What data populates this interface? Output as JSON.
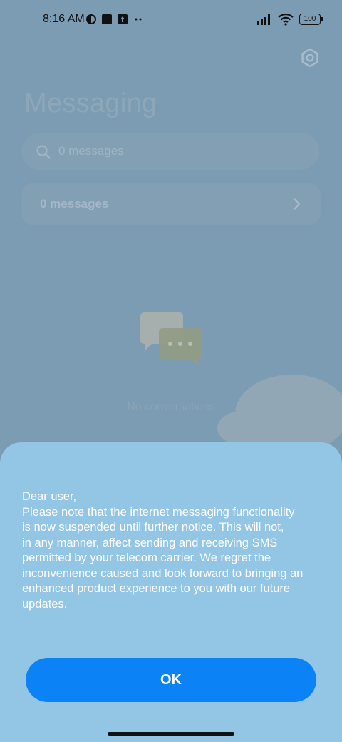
{
  "status_bar": {
    "time": "8:16 AM",
    "battery": "100",
    "left_icons": [
      "vpn-icon",
      "square-icon",
      "upload-icon",
      "more-dots-icon"
    ],
    "right_icons": [
      "signal-icon",
      "wifi-icon",
      "battery-icon"
    ]
  },
  "header": {
    "title": "Messaging",
    "settings_icon": "gear-icon"
  },
  "search": {
    "placeholder": "0 messages"
  },
  "messages_row": {
    "label": "0 messages"
  },
  "empty_state": {
    "text": "No conversations"
  },
  "dialog": {
    "lines": [
      "Dear user,",
      "Please note that the internet messaging functionality",
      "is now suspended until further notice. This will not,",
      "in any manner, affect sending and receiving SMS",
      "permitted by your telecom carrier. We regret the",
      "inconvenience caused and look forward to bringing an",
      "enhanced product experience to you with our future",
      "updates."
    ],
    "ok_label": "OK"
  },
  "colors": {
    "accent": "#0b82f5",
    "dialog_bg": "#93c5e5",
    "backdrop": "#7b9cb3"
  }
}
